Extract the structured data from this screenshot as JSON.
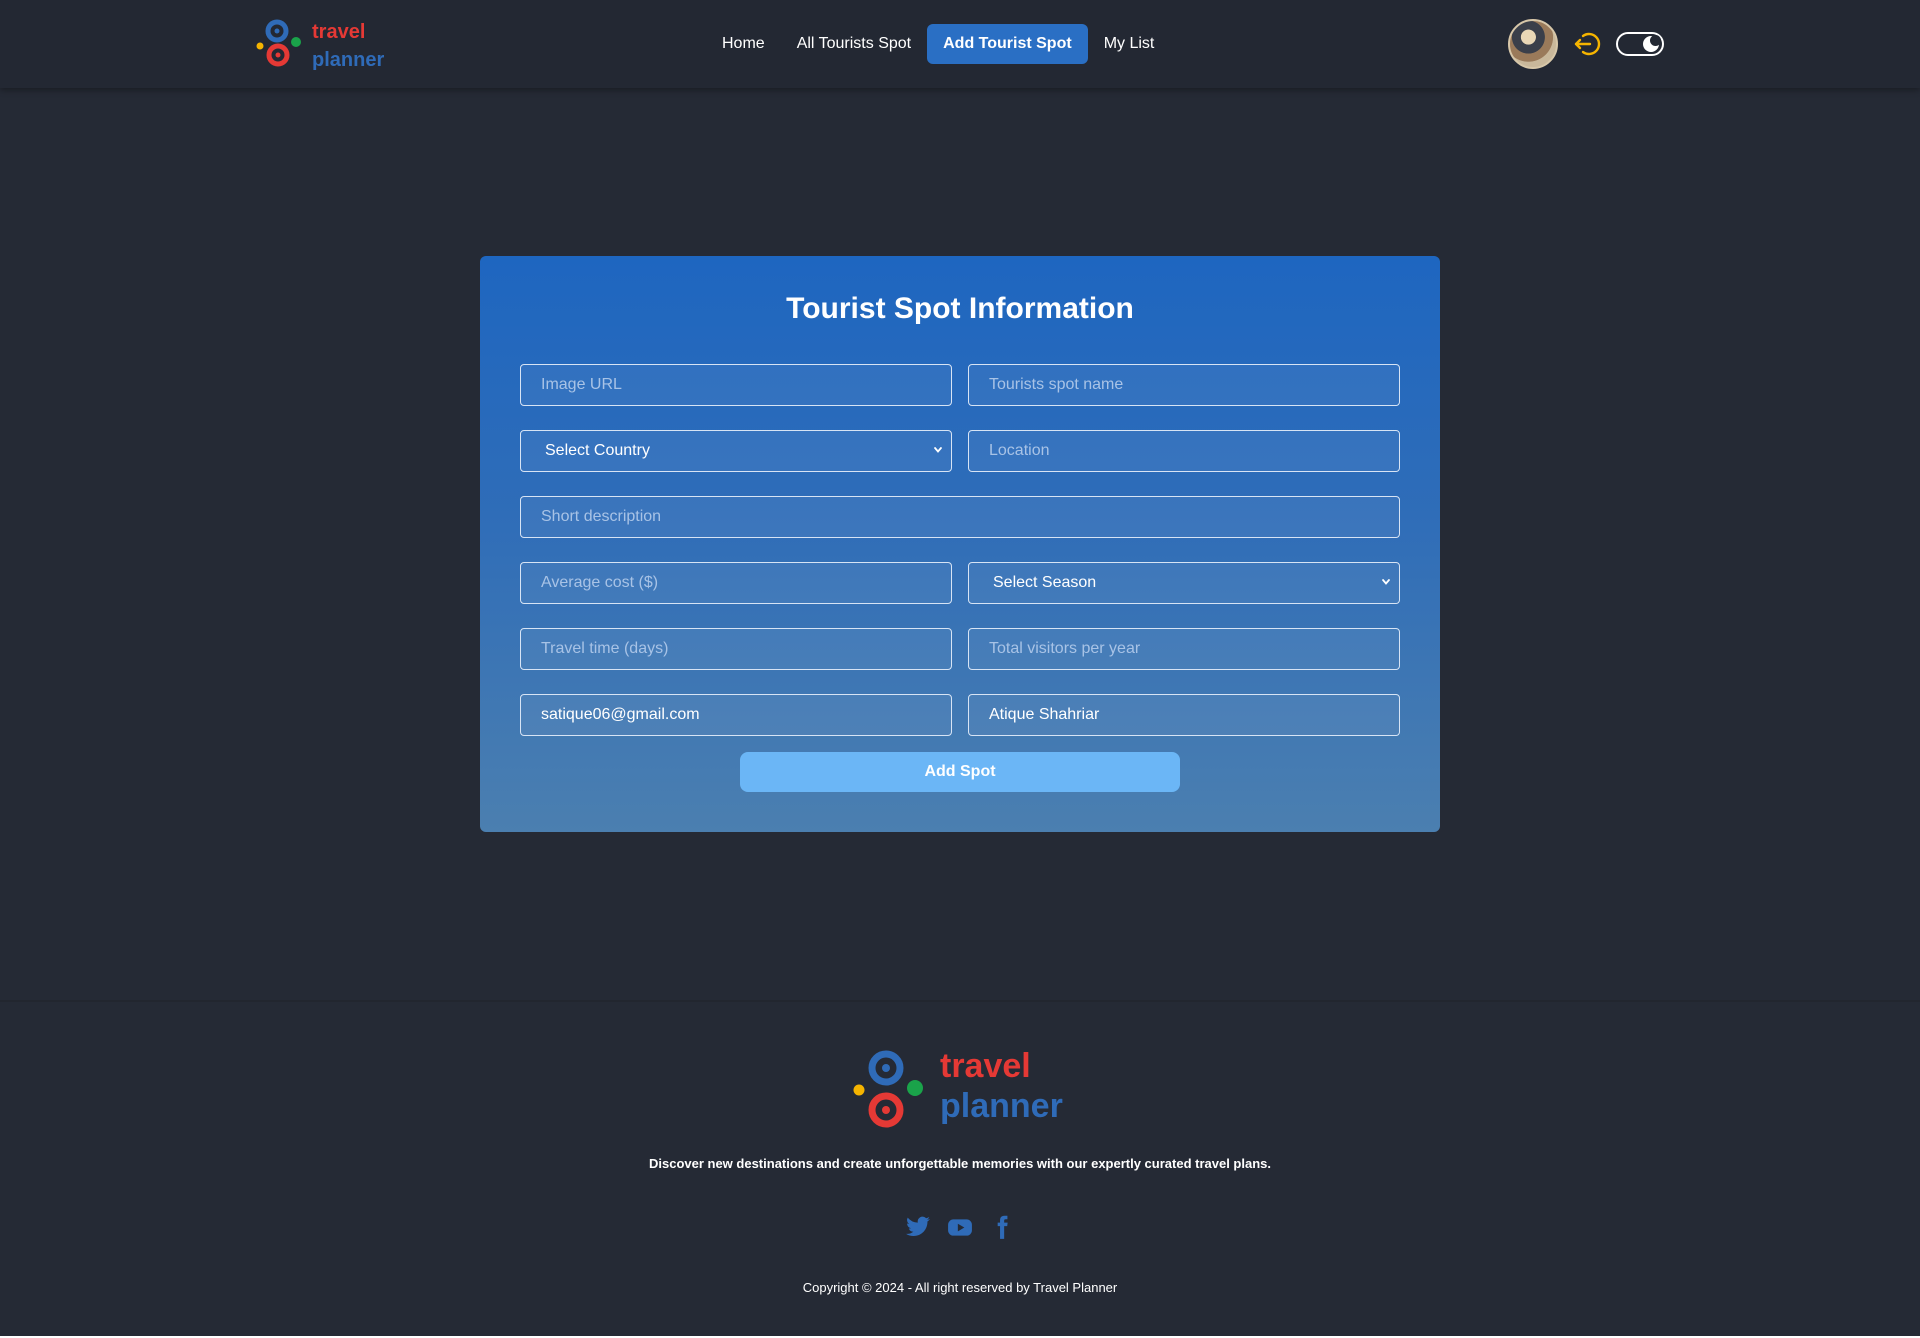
{
  "brand": {
    "line1": "travel",
    "line2": "planner",
    "colors": {
      "red": "#e53935",
      "blue": "#2f6bb8",
      "green": "#1aa34a",
      "yellow": "#f5b400"
    }
  },
  "nav": {
    "links": [
      {
        "label": "Home",
        "active": false
      },
      {
        "label": "All Tourists Spot",
        "active": false
      },
      {
        "label": "Add Tourist Spot",
        "active": true
      },
      {
        "label": "My List",
        "active": false
      }
    ],
    "accent": "#2a6fc4"
  },
  "header_icons": {
    "logout": "logout-icon",
    "theme": "theme-toggle-icon",
    "avatar": "user-avatar"
  },
  "form": {
    "title": "Tourist Spot Information",
    "image_url": {
      "placeholder": "Image URL",
      "value": ""
    },
    "spot_name": {
      "placeholder": "Tourists spot name",
      "value": ""
    },
    "country": {
      "selected": "Select Country"
    },
    "location": {
      "placeholder": "Location",
      "value": ""
    },
    "short_description": {
      "placeholder": "Short description",
      "value": ""
    },
    "average_cost": {
      "placeholder": "Average cost ($)",
      "value": ""
    },
    "season": {
      "selected": "Select Season"
    },
    "travel_time": {
      "placeholder": "Travel time (days)",
      "value": ""
    },
    "total_visitors": {
      "placeholder": "Total visitors per year",
      "value": ""
    },
    "user_email": {
      "value": "satique06@gmail.com"
    },
    "user_name": {
      "value": "Atique Shahriar"
    },
    "submit_label": "Add Spot"
  },
  "footer": {
    "tagline": "Discover new destinations and create unforgettable memories with our expertly curated travel plans.",
    "socials": [
      "twitter-icon",
      "youtube-icon",
      "facebook-icon"
    ],
    "copyright": "Copyright © 2024 - All right reserved by Travel Planner"
  }
}
